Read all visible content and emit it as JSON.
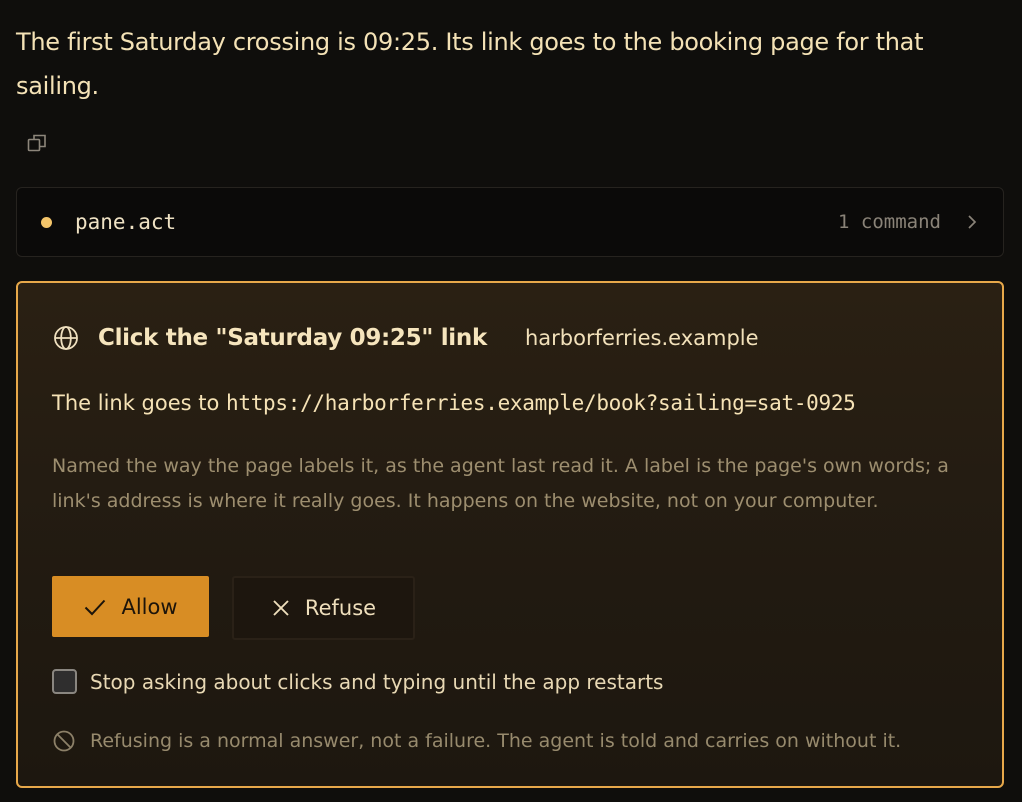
{
  "message": {
    "text": "The first Saturday crossing is 09:25. Its link goes to the booking page for that sailing."
  },
  "copy_icon": "copy-icon",
  "tool_call": {
    "name": "pane.act",
    "count": "1 command",
    "status_color": "#f4c56a"
  },
  "approval": {
    "title": "Click the \"Saturday 09:25\" link",
    "domain": "harborferries.example",
    "target_prefix": "The link goes to ",
    "target_url": "https://harborferries.example/book?sailing=sat-0925",
    "description": "Named the way the page labels it, as the agent last read it. A label is the page's own words; a link's address is where it really goes. It happens on the website, not on your computer.",
    "allow_label": "Allow",
    "refuse_label": "Refuse",
    "remember_label": "Stop asking about clicks and typing until the app restarts",
    "remember_checked": false,
    "note": "Refusing is a normal answer, not a failure. The agent is told and carries on without it.",
    "accent_color": "#e7a84a",
    "allow_color": "#d88d24"
  }
}
